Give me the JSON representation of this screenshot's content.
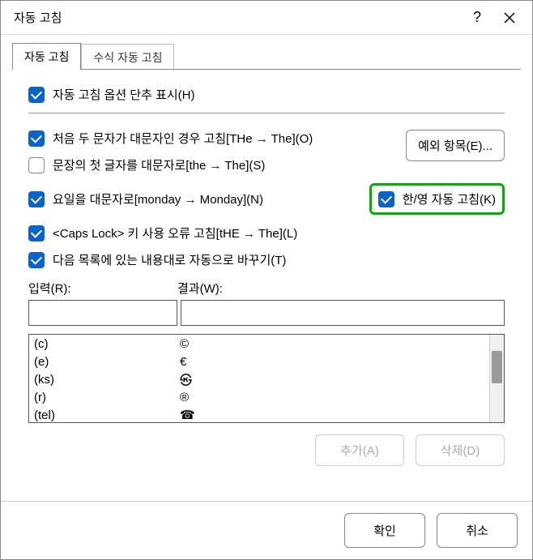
{
  "titlebar": {
    "title": "자동 고침",
    "help": "?",
    "close": "✕"
  },
  "tabs": {
    "t1": "자동 고침",
    "t2": "수식 자동 고침"
  },
  "options": {
    "show_button": "자동 고침 옵션 단추 표시(H)",
    "two_initial_caps": "처음 두 문자가 대문자인 경우 고침[THe → The](O)",
    "capitalize_sentence": "문장의 첫 글자를 대문자로[the → The](S)",
    "capitalize_days": "요일을 대문자로[monday → Monday](N)",
    "caps_lock": "<Caps Lock> 키 사용 오류 고침[tHE → The](L)",
    "replace_text": "다음 목록에 있는 내용대로 자동으로 바꾸기(T)",
    "han_eng": "한/영 자동 고침(K)",
    "exceptions_btn": "예외 항목(E)..."
  },
  "fields": {
    "input_label": "입력(R):",
    "result_label": "결과(W):",
    "input_value": "",
    "result_value": ""
  },
  "list": [
    {
      "in": "(c)",
      "out": "©"
    },
    {
      "in": "(e)",
      "out": "€"
    },
    {
      "in": "(ks)",
      "out": "㉿"
    },
    {
      "in": "(r)",
      "out": "®"
    },
    {
      "in": "(tel)",
      "out": "☎"
    }
  ],
  "list_actions": {
    "add": "추가(A)",
    "delete": "삭제(D)"
  },
  "footer": {
    "ok": "확인",
    "cancel": "취소"
  }
}
